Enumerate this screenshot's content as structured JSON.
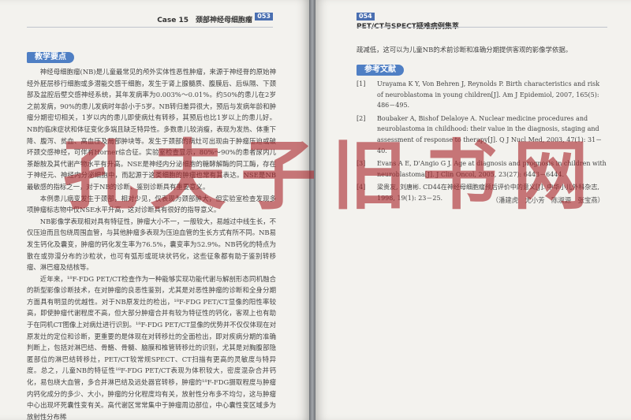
{
  "left_page": {
    "running_head": "Case 15　颈部神经母细胞瘤",
    "page_number": "053",
    "section_title": "教学要点",
    "paragraphs": [
      "神经母细胞瘤(NB)是儿童最常见的颅外实体性恶性肿瘤，来源于神经脊的原始神经外胚层移行细胞或多潜能交感干细胞，发生于肾上腺髓质、腹膜后、后纵隔、下颈部及盆腔后壁交感神经系统，其年发病率为0.003%～0.01%。约50%的患儿在2岁之前发病，90%的患儿发病时年龄小于5岁。NB转归差异很大，预后与发病年龄和肿瘤分期密切相关，1岁以内的患儿即使病灶有转移，其预后也比1岁以上的患儿好。NB的临床症状和体征变化多端且缺乏特异性。多数患儿较消瘦，表现为发热、体重下降、腹泻、贫血、高血压及局部肿块等。发生于颈部的病灶可出现由于肿瘤压迫或破坏颈交感神经，可伴有Horner综合征。实验室检查显示，80%～90%的患者尿内儿茶酚胺及其代谢产物水平有升高。NSE是神经内分泌细胞的糖酵解酶的同工酶，存在于神经元、神经内分泌细胞中，而起源于这类细胞的肿瘤也常有其表达。NSE是NB最敏感的指标之一，对于NB的诊断、鉴别诊断具有重要意义。",
      "本例患儿病变发生于颈部，相对少见，仅表现为颈部肿大，但实验室检查发现多项肿瘤标志物中仅NSE水平升高，这对诊断具有很好的指导意义。",
      "NB影像学表现相对具有特征性，肿瘤大小不一，一般较大，易越过中线生长，不仅压迫而且包绕周围血管，与其他肿瘤多表现为压迫血管的生长方式有所不同。NB易发生钙化及囊变，肿瘤的钙化发生率为76.5%，囊变率为52.9%。NB钙化的特点为散在或弥漫分布的沙粒状，也可有弧形或斑块状钙化，这些征象都有助于鉴别转移瘤、淋巴瘤及结核等。",
      "近年来，¹⁸F-FDG PET/CT检查作为一种能够实现功能代谢与解剖形态同机融合的新型影像诊断技术，在对肿瘤的良恶性鉴别，尤其是对恶性肿瘤的诊断和全身分期方面具有明显的优越性。对于NB原发灶的检出，¹⁸F-FDG PET/CT显像的阳性率较高，即使肿瘤代谢程度不高，但大部分肿瘤合并有较为特征性的钙化，客观上也有助于在同机CT图像上对病灶进行识别。¹⁸F-FDG PET/CT显像的优势并不仅仅体现在对原发灶的定位和诊断，更重要的是体现在对转移灶的全面检出，即对疾病分期的准确判断上，包括对淋巴结、骨骼、骨髓、脑膜和椎管转移灶的识别，尤其是对胸腹部隐匿部位的淋巴结转移灶，PET/CT较常规SPECT、CT扫描有更高的灵敏度与特异度。总之，儿童NB的特征性¹⁸F-FDG PET/CT表现为体积较大，密度混杂合并钙化，易包绕大血管，多合并淋巴结及远处器官转移，肿瘤的¹⁸F-FDG摄取程度与肿瘤内钙化成分的多少、大小，肿瘤的分化程度均有关，放射性分布多不均匀，这与肿瘤中心出现坏死囊性变有关。高代谢区常常集中于肿瘤周边部位，中心囊性变区域多为放射性分布稀"
    ]
  },
  "right_page": {
    "page_number": "054",
    "running_head": "PET/CT与SPECT疑难病例集萃",
    "lead_text": "疏减低，这可以为儿童NB的术前诊断和准确分期提供客观的影像学依据。",
    "section_title": "参考文献",
    "references": [
      {
        "num": "[1]",
        "text": "Urayama K Y, Von Behren J, Reynolds P. Birth characteristics and risk of neuroblastoma in young children[J]. Am J Epidemiol, 2007, 165(5): 486－495."
      },
      {
        "num": "[2]",
        "text": "Boubaker A, Bishof Delaloye A. Nuclear medicine procedures and neuroblastoma in childhood: their value in the diagnosis, staging and assessment of response to therapy[J]. Q J Nucl Med, 2003, 47(1): 31－40."
      },
      {
        "num": "[3]",
        "text": "Evans A E, D'Angio G J. Age at diagnosis and prognosis in children with neuroblastoma[J]. J Clin Oncol, 2005, 23(27): 6443－6444."
      },
      {
        "num": "[4]",
        "text": "梁贵友, 刘唐彬. CD44在神经母细胞瘤预后评价中的意义[J]. 中华小儿外科杂志, 1998, 19(1): 23－25."
      }
    ],
    "authors": "（潘建虎　尤小芳　陈淑源　张宝燕）"
  },
  "watermark": {
    "chars": [
      "孔",
      "夫",
      "子",
      "旧",
      "书",
      "网"
    ]
  },
  "colors": {
    "accent_blue": "#4f7fc4",
    "page_bg": "#f3f2ee",
    "watermark_red": "#aa282d"
  }
}
